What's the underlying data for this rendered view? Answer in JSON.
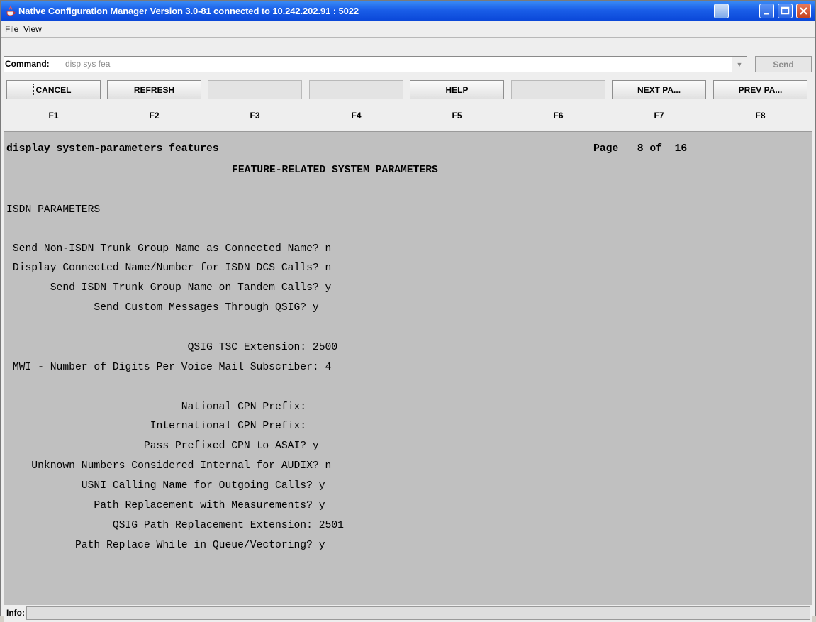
{
  "window": {
    "title": "Native Configuration Manager Version 3.0-81 connected to 10.242.202.91 : 5022",
    "icon": "java-cup-icon"
  },
  "menu": {
    "items": [
      "File",
      "View"
    ]
  },
  "command": {
    "label": "Command:",
    "value": "disp sys fea",
    "send_label": "Send"
  },
  "function_keys": [
    {
      "button": "CANCEL",
      "key": "F1"
    },
    {
      "button": "REFRESH",
      "key": "F2"
    },
    {
      "button": "",
      "key": "F3"
    },
    {
      "button": "",
      "key": "F4"
    },
    {
      "button": "HELP",
      "key": "F5"
    },
    {
      "button": "",
      "key": "F6"
    },
    {
      "button": "NEXT PA...",
      "key": "F7"
    },
    {
      "button": "PREV PA...",
      "key": "F8"
    }
  ],
  "screen": {
    "command_text": "display system-parameters features",
    "page": "Page   8 of  16",
    "heading": "FEATURE-RELATED SYSTEM PARAMETERS",
    "section": "ISDN PARAMETERS",
    "lines": [
      " Send Non-ISDN Trunk Group Name as Connected Name? n",
      " Display Connected Name/Number for ISDN DCS Calls? n",
      "       Send ISDN Trunk Group Name on Tandem Calls? y",
      "              Send Custom Messages Through QSIG? y",
      "",
      "                             QSIG TSC Extension: 2500",
      " MWI - Number of Digits Per Voice Mail Subscriber: 4",
      "",
      "                            National CPN Prefix:",
      "                       International CPN Prefix:",
      "                      Pass Prefixed CPN to ASAI? y",
      "    Unknown Numbers Considered Internal for AUDIX? n",
      "            USNI Calling Name for Outgoing Calls? y",
      "              Path Replacement with Measurements? y",
      "                 QSIG Path Replacement Extension: 2501",
      "           Path Replace While in Queue/Vectoring? y"
    ]
  },
  "info": {
    "label": "Info:",
    "value": ""
  }
}
